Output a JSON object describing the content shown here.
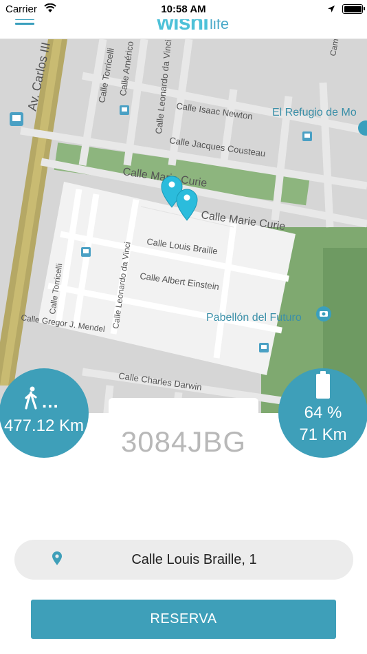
{
  "status_bar": {
    "carrier": "Carrier",
    "time": "10:58 AM"
  },
  "nav": {
    "logo_main": "wishi",
    "logo_sub": "life"
  },
  "map": {
    "streets": [
      "Av. Carlos III",
      "Calle Torricelli",
      "Calle Américo",
      "Calle Leonardo da Vinci",
      "Calle Isaac Newton",
      "Calle Jacques Cousteau",
      "Calle Marie Curie",
      "Calle Marie Curie",
      "Calle Louis Braille",
      "Calle Albert Einstein",
      "Calle Torricelli",
      "Calle Leonardo da Vinci",
      "Calle Gregor J. Mendel",
      "Calle Charles Darwin",
      "Cam"
    ],
    "places": [
      "El Refugio de Mo",
      "Pabellón del Futuro"
    ]
  },
  "trip": {
    "distance": "477.12 Km",
    "dots": "..."
  },
  "battery": {
    "percent": "64 %",
    "range": "71 Km"
  },
  "vehicle": {
    "plate": "3084JBG"
  },
  "address": {
    "text": "Calle Louis Braille,  1"
  },
  "actions": {
    "reserve_label": "RESERVA"
  },
  "colors": {
    "accent": "#3e9fb9",
    "logo": "#4ec1d8",
    "map_bg": "#d6d6d6",
    "zone": "#f2f2f2",
    "park": "#7fa970",
    "poi": "#3a9fbd"
  }
}
